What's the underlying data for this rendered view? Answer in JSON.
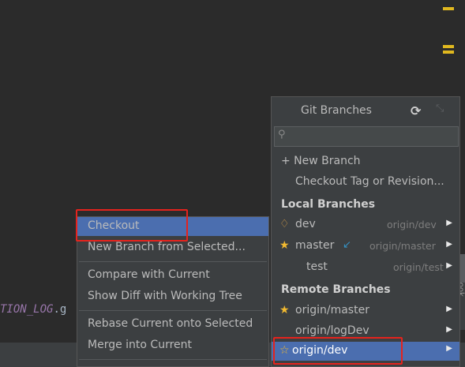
{
  "editor": {
    "code_fragment": "TION_LOG",
    "code_fragment_ext": ".g"
  },
  "side_panel": {
    "label": "Word Book"
  },
  "git_branches": {
    "title": "Git Branches",
    "icons": {
      "refresh": "refresh-icon",
      "pin": "pin-icon",
      "search": "search-icon"
    },
    "search_placeholder": "",
    "actions": [
      {
        "label": "+ New Branch"
      },
      {
        "label": "Checkout Tag or Revision..."
      }
    ],
    "local_header": "Local Branches",
    "local": [
      {
        "name": "dev",
        "tracking": "origin/dev",
        "icon": "tag-icon"
      },
      {
        "name": "master",
        "tracking": "origin/master",
        "icon": "star-icon"
      },
      {
        "name": "test",
        "tracking": "origin/test",
        "icon": ""
      }
    ],
    "remote_header": "Remote Branches",
    "remote": [
      {
        "name": "origin/master",
        "icon": "star-icon",
        "selected": false
      },
      {
        "name": "origin/logDev",
        "icon": "",
        "selected": false
      },
      {
        "name": "origin/dev",
        "icon": "star-outline-icon",
        "selected": true
      }
    ]
  },
  "context_menu": {
    "items": [
      {
        "label": "Checkout",
        "selected": true
      },
      {
        "label": "New Branch from Selected..."
      },
      {
        "label": "Compare with Current"
      },
      {
        "label": "Show Diff with Working Tree"
      },
      {
        "label": "Rebase Current onto Selected"
      },
      {
        "label": "Merge into Current"
      }
    ]
  },
  "colors": {
    "editor_bg": "#2b2b2b",
    "popup_bg": "#3c3f41",
    "selection": "#4b6eaf",
    "highlight_box": "#e5231d",
    "star": "#f2ba30"
  }
}
